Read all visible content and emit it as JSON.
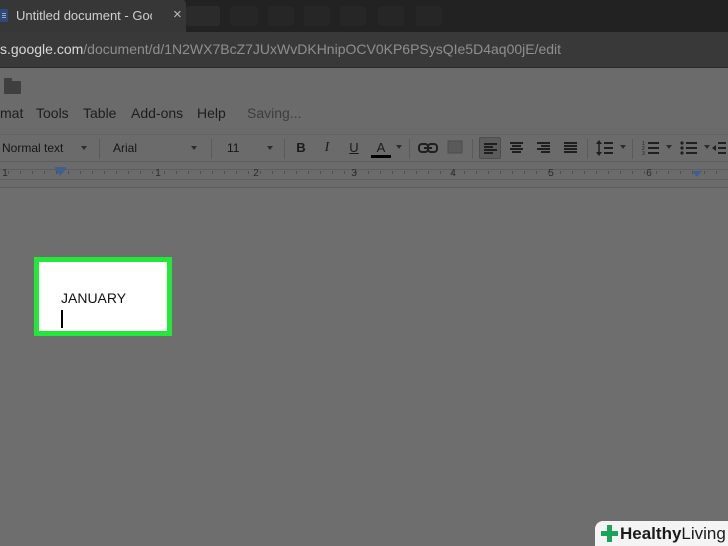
{
  "browser": {
    "tab_title": "Untitled document - Google Docs",
    "tab_close": "×",
    "url_host": "s.google.com",
    "url_path": "/document/d/1N2WX7BcZ7JUxWvDKHnipOCV0KP6PSysQIe5D4aq00jE/edit"
  },
  "docs": {
    "folder_icon": "folder-icon",
    "menu": [
      {
        "label": "mat"
      },
      {
        "label": "Tools"
      },
      {
        "label": "Table"
      },
      {
        "label": "Add-ons"
      },
      {
        "label": "Help"
      }
    ],
    "status": "Saving..."
  },
  "toolbar": {
    "style_value": "Normal text",
    "font_value": "Arial",
    "size_value": "11",
    "bold": "B",
    "italic": "I",
    "underline": "U",
    "text_color": "A",
    "text_color_hex": "#000000"
  },
  "ruler": {
    "numbers": [
      "1",
      "1",
      "2",
      "3",
      "4",
      "5",
      "6"
    ]
  },
  "document": {
    "text": "JANUARY"
  },
  "highlight_color": "#22e83a",
  "watermark": {
    "part1": "Healthy",
    "part2": "Living"
  }
}
